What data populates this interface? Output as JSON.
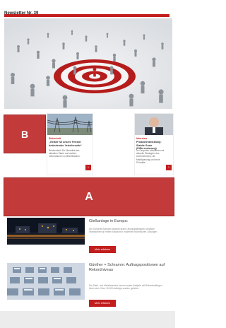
{
  "header": {
    "title": "Newsletter Nr. 39"
  },
  "labels": {
    "b": "B",
    "a": "A"
  },
  "cards": [
    {
      "category": "Sicherheit",
      "headline": "„Gefahr für unsere Fenster bedeutender Verteilersuite“",
      "teaser": "Brückenfeld: Ein Überblick des aktuellen Stand und weitere Informationen zu Möbelbänken.",
      "more": "›"
    },
    {
      "category": "Interview",
      "headline": "Produktentwicklung: Stabile Gurte (Differenzierung)",
      "teaser": "Im Gespräch diskutieren wir aktuelle Strategien des Unternehmens, die Marktplanung und neue Produkte.",
      "more": "›"
    }
  ],
  "articles": [
    {
      "title": "Gießanlage in Europa:",
      "teaser": "Der Gießerei-Standort bewährt seine Leistungsfähigkeit: Mögliche Investitionen an einem Standort in modernen technischen Lösungen.",
      "button": "Mehr erfahren"
    },
    {
      "title": "Günther + Schramm: Auftragspositionen auf Rekordniveau",
      "teaser": "Die Stahl- und Metallbranche hat ein erstes Halbjahr mit Rekordaufträgen hinter sich. Über 10.000 Aufträge wurden geliefert.",
      "button": "Mehr erfahren"
    }
  ],
  "colors": {
    "accent": "#c21e1e",
    "overlay": "#c23a3a",
    "footer": "#ececec"
  }
}
